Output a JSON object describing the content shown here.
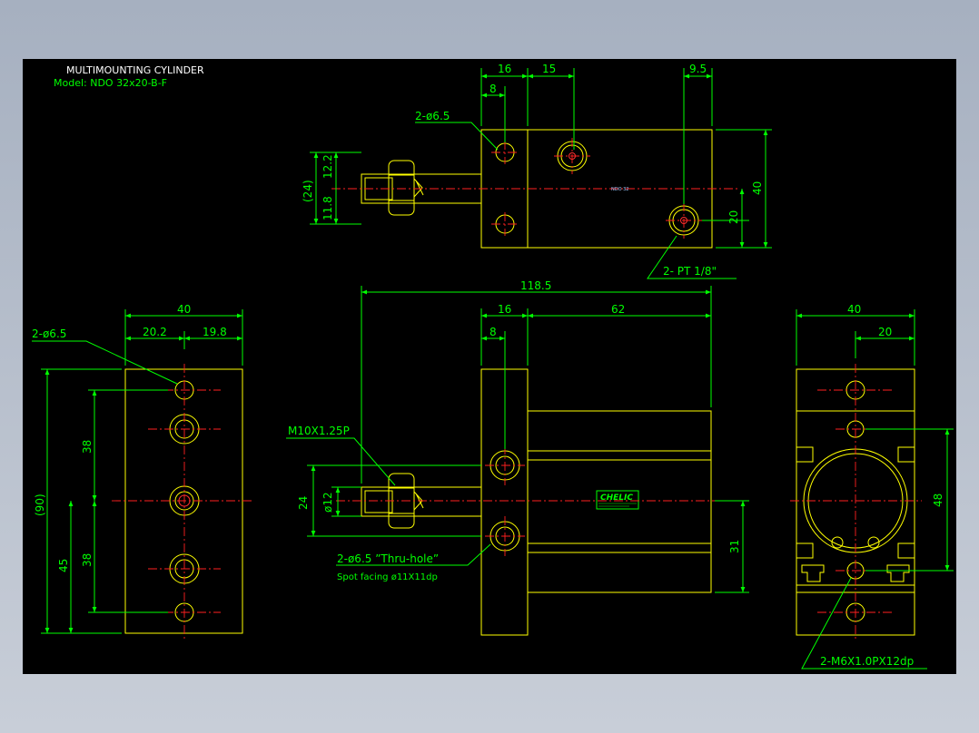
{
  "drawing": {
    "title": "MULTIMOUNTING CYLINDER",
    "model": "Model: NDO 32x20-B-F"
  },
  "top_view": {
    "dims": {
      "d16": "16",
      "d15": "15",
      "d9_5": "9.5",
      "d8": "8",
      "d12_2": "12.2",
      "d11_8": "11.8",
      "d24p": "(24)",
      "d40": "40",
      "d20": "20"
    },
    "hole_note": "2-ø6.5",
    "port_note": "2- PT 1/8\"",
    "center_tag": "NDO 32"
  },
  "left_view": {
    "dims": {
      "d40": "40",
      "d20_2": "20.2",
      "d19_8": "19.8",
      "d90p": "(90)",
      "d38a": "38",
      "d38b": "38",
      "d45": "45"
    },
    "hole_note": "2-ø6.5"
  },
  "front_view": {
    "dims": {
      "d118_5": "118.5",
      "d16": "16",
      "d62": "62",
      "d8": "8",
      "d24": "24",
      "d12": "ø12",
      "d31": "31"
    },
    "thread_note": "M10X1.25P",
    "hole_note": "2-ø6.5 ”Thru-hole”",
    "spot_note": "Spot facing   ø11X11dp",
    "brand": "CHELIC"
  },
  "right_view": {
    "dims": {
      "d40": "40",
      "d20": "20",
      "d48": "48"
    },
    "thread_note": "2-M6X1.0PX12dp"
  },
  "colors": {
    "background": "#000000",
    "outline": "#ffff00",
    "dimension": "#00ff00",
    "centerline": "#ff0000",
    "text": "#ffffff",
    "frame": "#a6b0c0"
  }
}
